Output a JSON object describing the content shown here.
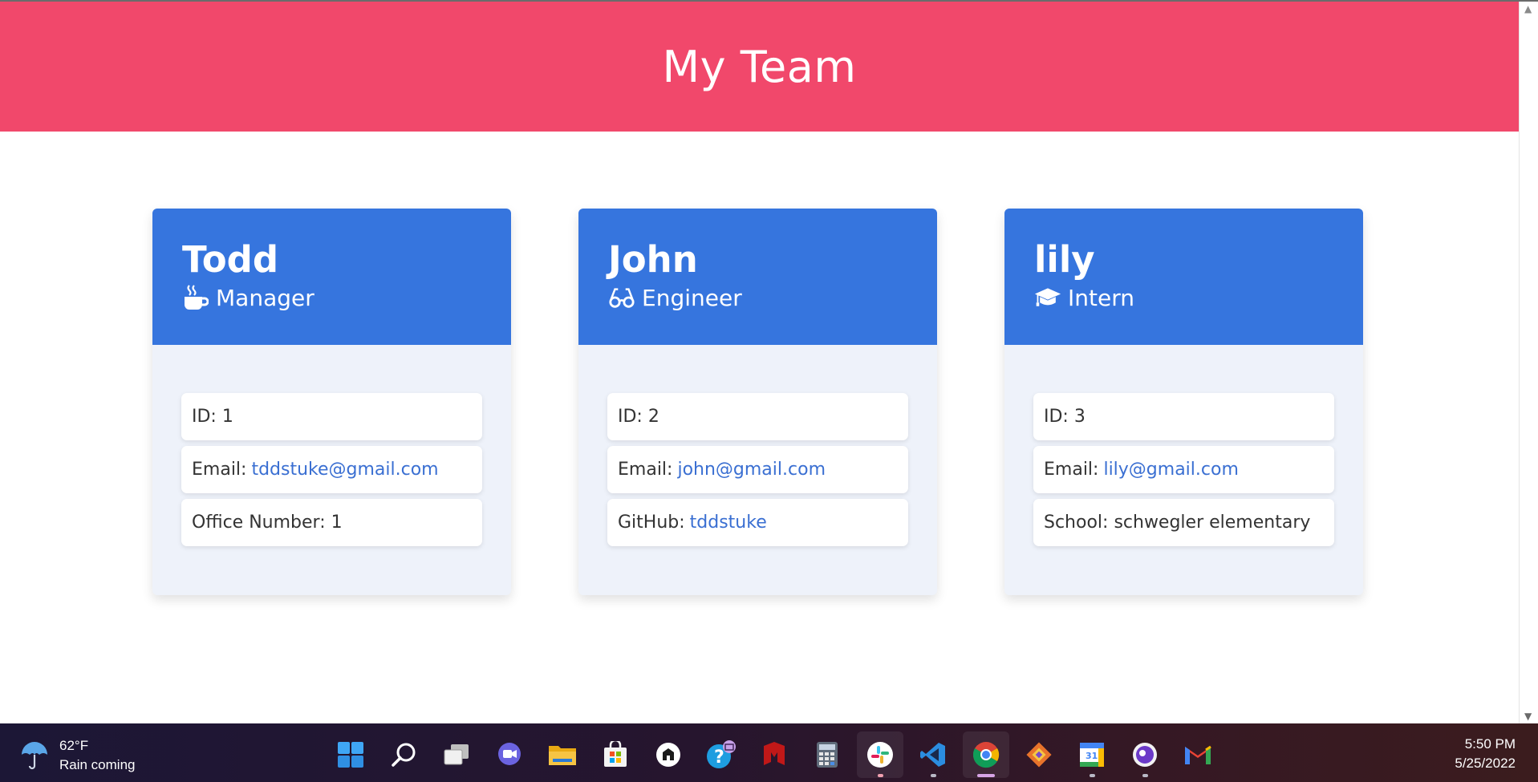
{
  "header": {
    "title": "My Team"
  },
  "employees": [
    {
      "name": "Todd",
      "role": "Manager",
      "icon": "mug-icon",
      "id_label": "ID: 1",
      "email_label": "Email:",
      "email": "tddstuke@gmail.com",
      "extra_label": "Office Number: 1",
      "extra_link": ""
    },
    {
      "name": "John",
      "role": "Engineer",
      "icon": "glasses-icon",
      "id_label": "ID: 2",
      "email_label": "Email:",
      "email": "john@gmail.com",
      "extra_label": "GitHub:",
      "extra_link": "tddstuke"
    },
    {
      "name": "lily",
      "role": "Intern",
      "icon": "graduation-cap-icon",
      "id_label": "ID: 3",
      "email_label": "Email:",
      "email": "lily@gmail.com",
      "extra_label": "School: schwegler elementary",
      "extra_link": ""
    }
  ],
  "taskbar": {
    "weather": {
      "temp": "62°F",
      "desc": "Rain coming",
      "icon": "umbrella-icon"
    },
    "apps": [
      "start-icon",
      "search-icon",
      "task-view-icon",
      "teams-chat-icon",
      "file-explorer-icon",
      "microsoft-store-icon",
      "app-icon",
      "help-icon",
      "mcafee-icon",
      "calculator-icon",
      "slack-icon",
      "vscode-icon",
      "chrome-icon",
      "git-icon",
      "google-calendar-icon",
      "media-icon",
      "gmail-icon"
    ],
    "clock": {
      "time": "5:50 PM",
      "date": "5/25/2022"
    }
  },
  "colors": {
    "header": "#f1486b",
    "card_head": "#3675de",
    "card_body": "#eef2fa",
    "link": "#3a6fd2"
  }
}
